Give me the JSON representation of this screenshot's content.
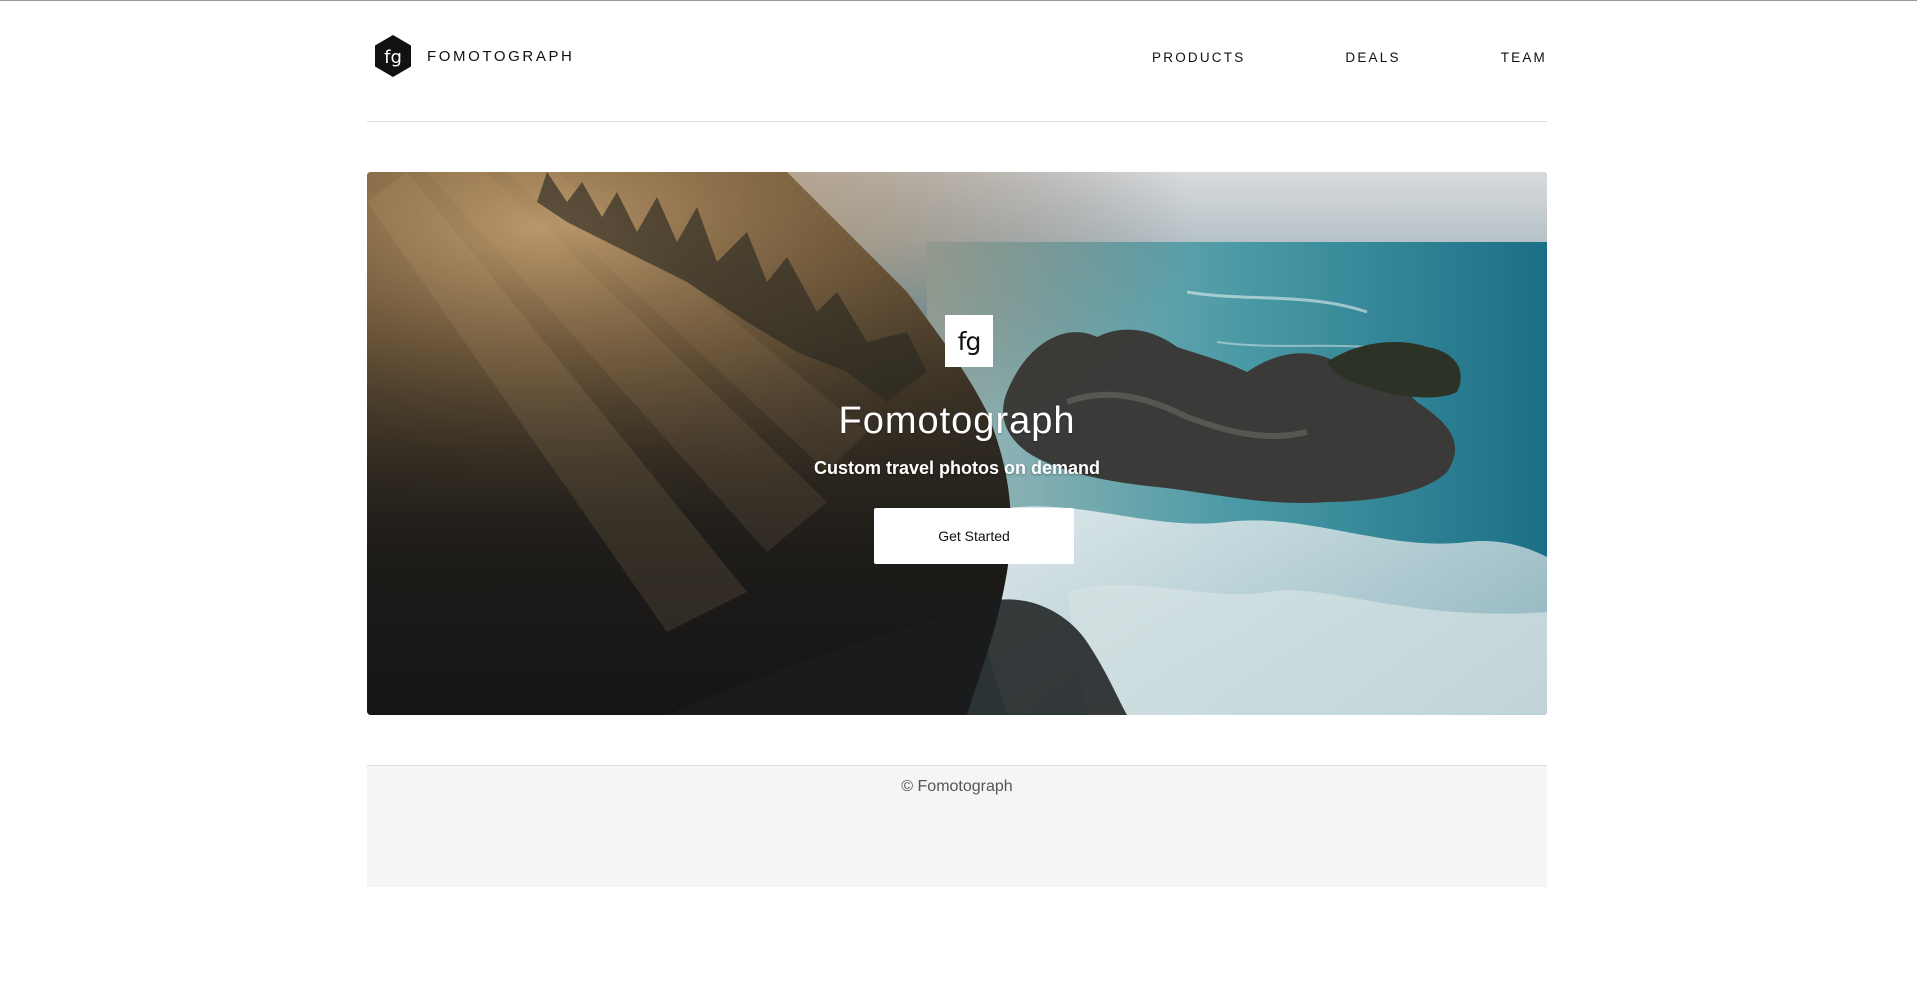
{
  "brand": {
    "logo_text": "fg",
    "name": "FOMOTOGRAPH",
    "logo_icon": "hexagon-logo-icon"
  },
  "nav": {
    "items": [
      {
        "label": "PRODUCTS"
      },
      {
        "label": "DEALS"
      },
      {
        "label": "TEAM"
      }
    ]
  },
  "hero": {
    "logo_text": "fg",
    "title": "Fomotograph",
    "subtitle": "Custom travel photos on demand",
    "cta_label": "Get Started"
  },
  "footer": {
    "copyright": "© Fomotograph"
  },
  "colors": {
    "text": "#111111",
    "divider": "#dedede",
    "footer_bg": "#f6f5f5",
    "footer_text": "#555555",
    "button_bg": "#ffffff"
  }
}
